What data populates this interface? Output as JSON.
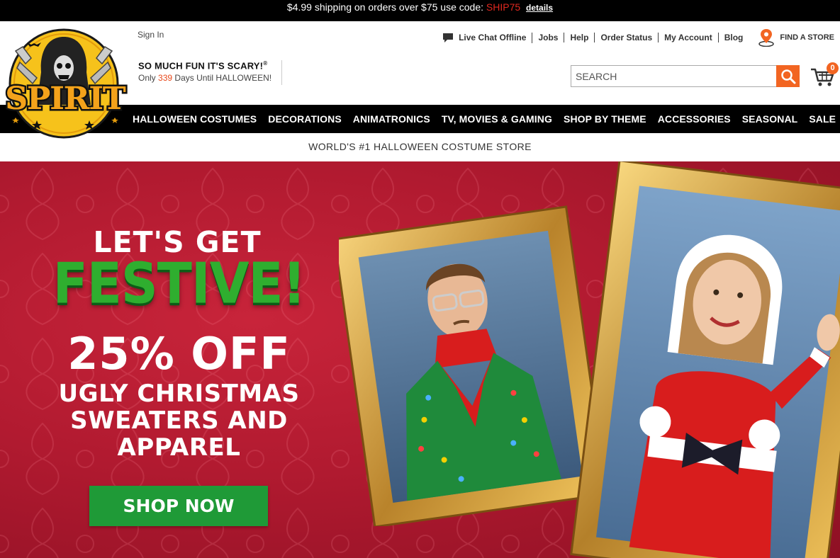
{
  "promo": {
    "text": "$4.99 shipping on orders over $75 use code:",
    "code": "SHIP75",
    "details": "details"
  },
  "header": {
    "logo_text": "SPIRIT",
    "sign_in": "Sign In",
    "tagline": "SO MUCH FUN IT'S SCARY!",
    "tagline_mark": "®",
    "countdown_prefix": "Only",
    "countdown_days": "339",
    "countdown_suffix": "Days Until HALLOWEEN!",
    "util_links": {
      "live_chat": "Live Chat Offline",
      "jobs": "Jobs",
      "help": "Help",
      "order_status": "Order Status",
      "my_account": "My Account",
      "blog": "Blog",
      "find_store": "FIND A STORE"
    },
    "search_placeholder": "SEARCH",
    "cart_count": "0"
  },
  "nav": {
    "items": [
      "HALLOWEEN COSTUMES",
      "DECORATIONS",
      "ANIMATRONICS",
      "TV, MOVIES & GAMING",
      "SHOP BY THEME",
      "ACCESSORIES",
      "SEASONAL",
      "SALE"
    ]
  },
  "subtagline": "WORLD'S #1 HALLOWEEN COSTUME STORE",
  "hero": {
    "line1": "LET'S GET",
    "line2": "FESTIVE!",
    "line3": "25% OFF",
    "line4": "UGLY CHRISTMAS",
    "line5": "SWEATERS AND",
    "line6": "APPAREL",
    "cta": "SHOP NOW"
  },
  "colors": {
    "accent_orange": "#f26522",
    "hero_red": "#b11a30",
    "festive_green": "#2fae2f",
    "cta_green": "#1f9a37",
    "promo_code_red": "#e0281f"
  }
}
